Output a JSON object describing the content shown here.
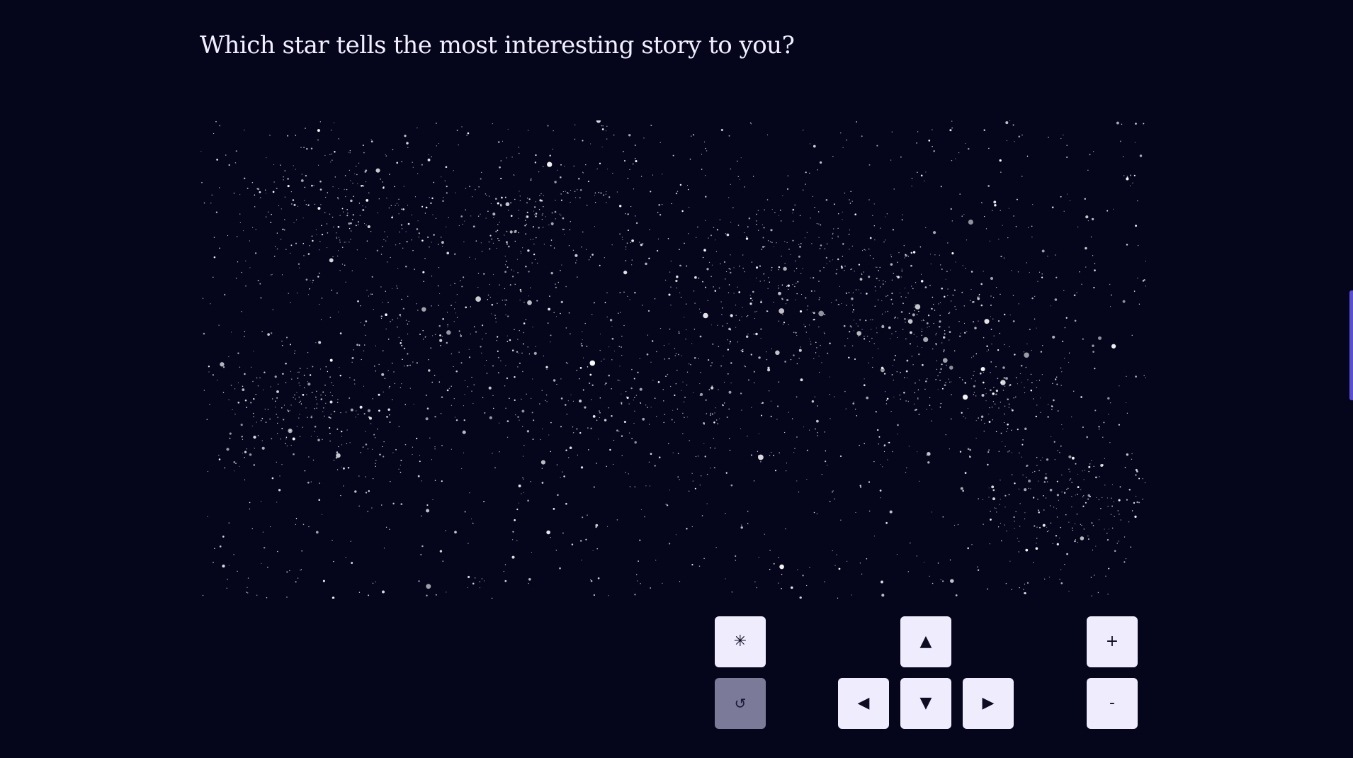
{
  "question": "Which star tells the most interesting story to you?",
  "controls": {
    "select_symbol": "✳",
    "reset_symbol": "↺",
    "up_symbol": "▲",
    "down_symbol": "▼",
    "left_symbol": "◀",
    "right_symbol": "▶",
    "zoom_in_symbol": "+",
    "zoom_out_symbol": "-"
  },
  "colors": {
    "background": "#05051c",
    "star": "#ffffff",
    "button": "#efedfd",
    "button_disabled": "#7b7a99",
    "accent": "#5b4fd1"
  }
}
